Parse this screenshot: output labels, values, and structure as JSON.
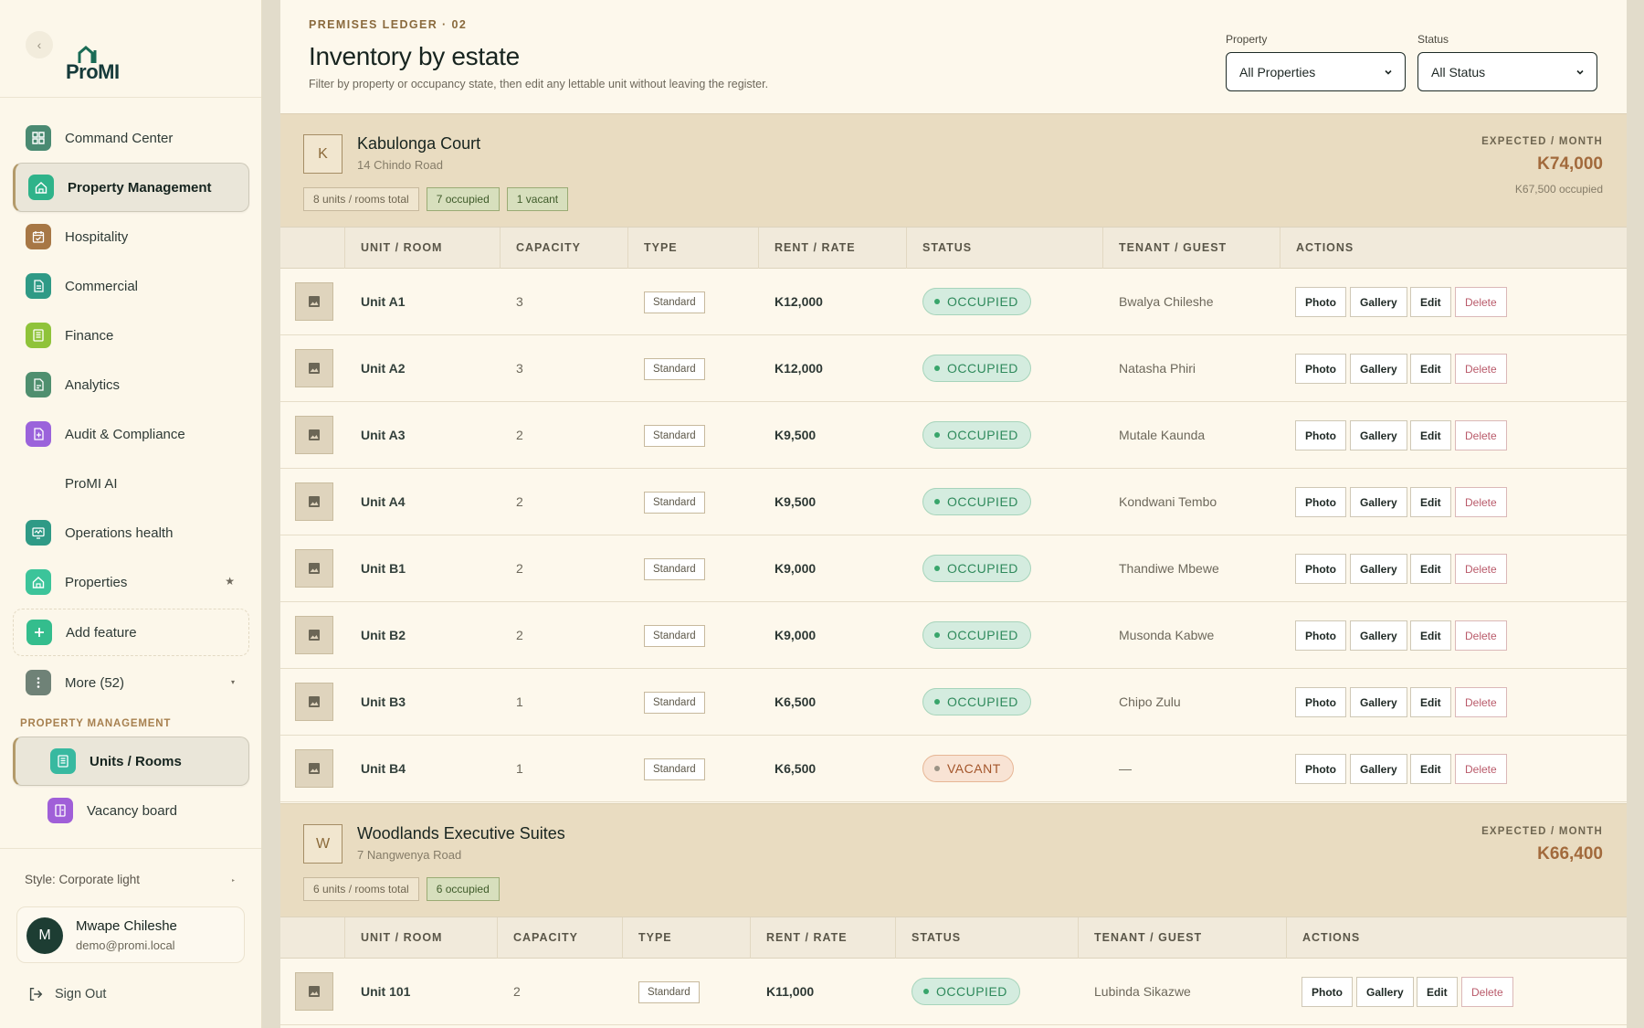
{
  "sidebar": {
    "logo": "ProMI",
    "nav": [
      {
        "label": "Command Center",
        "icon": "grid-icon",
        "color": "#4a8a72",
        "active": false
      },
      {
        "label": "Property Management",
        "icon": "home-icon",
        "color": "#2fb38a",
        "active": true
      },
      {
        "label": "Hospitality",
        "icon": "calendar-icon",
        "color": "#a77745",
        "active": false
      },
      {
        "label": "Commercial",
        "icon": "document-icon",
        "color": "#2f9a86",
        "active": false
      },
      {
        "label": "Finance",
        "icon": "ledger-icon",
        "color": "#8fc33a",
        "active": false
      },
      {
        "label": "Analytics",
        "icon": "report-icon",
        "color": "#4f8f6f",
        "active": false
      },
      {
        "label": "Audit & Compliance",
        "icon": "audit-icon",
        "color": "#9b63db",
        "active": false
      },
      {
        "label": "ProMI AI",
        "icon": "",
        "color": "",
        "active": false
      },
      {
        "label": "Operations health",
        "icon": "monitor-icon",
        "color": "#2f9a86",
        "active": false
      },
      {
        "label": "Properties",
        "icon": "home-icon",
        "color": "#3cc49a",
        "active": false,
        "star": "★"
      },
      {
        "label": "Add feature",
        "icon": "plus-icon",
        "color": "#34bd8d",
        "active": false
      },
      {
        "label": "More (52)",
        "icon": "more-icon",
        "color": "#6f8277",
        "active": false,
        "caret": "▾"
      }
    ],
    "section_label": "PROPERTY MANAGEMENT",
    "subnav": [
      {
        "label": "Units / Rooms",
        "icon": "units-icon",
        "color": "#38b9a0",
        "active": true
      },
      {
        "label": "Vacancy board",
        "icon": "board-icon",
        "color": "#a05fd8",
        "active": false
      }
    ],
    "style_label": "Style: Corporate light",
    "user": {
      "initial": "M",
      "name": "Mwape Chileshe",
      "email": "demo@promi.local"
    },
    "signout": "Sign Out"
  },
  "header": {
    "eyebrow": "PREMISES LEDGER · 02",
    "title": "Inventory by estate",
    "subtitle": "Filter by property or occupancy state, then edit any lettable unit without leaving the register.",
    "property_label": "Property",
    "property_value": "All Properties",
    "status_label": "Status",
    "status_value": "All Status"
  },
  "columns": [
    "UNIT / ROOM",
    "CAPACITY",
    "TYPE",
    "RENT / RATE",
    "STATUS",
    "TENANT / GUEST",
    "ACTIONS"
  ],
  "actions": {
    "photo": "Photo",
    "gallery": "Gallery",
    "edit": "Edit",
    "delete": "Delete"
  },
  "estates": [
    {
      "letter": "K",
      "name": "Kabulonga Court",
      "address": "14 Chindo Road",
      "chips": [
        {
          "text": "8 units / rooms total",
          "green": false
        },
        {
          "text": "7 occupied",
          "green": true
        },
        {
          "text": "1 vacant",
          "green": true
        }
      ],
      "expected_label": "EXPECTED / MONTH",
      "expected_value": "K74,000",
      "expected_occupied": "K67,500 occupied",
      "units": [
        {
          "unit": "Unit A1",
          "capacity": "3",
          "type": "Standard",
          "rent": "K12,000",
          "status": "OCCUPIED",
          "tenant": "Bwalya Chileshe"
        },
        {
          "unit": "Unit A2",
          "capacity": "3",
          "type": "Standard",
          "rent": "K12,000",
          "status": "OCCUPIED",
          "tenant": "Natasha Phiri"
        },
        {
          "unit": "Unit A3",
          "capacity": "2",
          "type": "Standard",
          "rent": "K9,500",
          "status": "OCCUPIED",
          "tenant": "Mutale Kaunda"
        },
        {
          "unit": "Unit A4",
          "capacity": "2",
          "type": "Standard",
          "rent": "K9,500",
          "status": "OCCUPIED",
          "tenant": "Kondwani Tembo"
        },
        {
          "unit": "Unit B1",
          "capacity": "2",
          "type": "Standard",
          "rent": "K9,000",
          "status": "OCCUPIED",
          "tenant": "Thandiwe Mbewe"
        },
        {
          "unit": "Unit B2",
          "capacity": "2",
          "type": "Standard",
          "rent": "K9,000",
          "status": "OCCUPIED",
          "tenant": "Musonda Kabwe"
        },
        {
          "unit": "Unit B3",
          "capacity": "1",
          "type": "Standard",
          "rent": "K6,500",
          "status": "OCCUPIED",
          "tenant": "Chipo Zulu"
        },
        {
          "unit": "Unit B4",
          "capacity": "1",
          "type": "Standard",
          "rent": "K6,500",
          "status": "VACANT",
          "tenant": "—"
        }
      ]
    },
    {
      "letter": "W",
      "name": "Woodlands Executive Suites",
      "address": "7 Nangwenya Road",
      "chips": [
        {
          "text": "6 units / rooms total",
          "green": false
        },
        {
          "text": "6 occupied",
          "green": true
        }
      ],
      "expected_label": "EXPECTED / MONTH",
      "expected_value": "K66,400",
      "expected_occupied": "",
      "units": [
        {
          "unit": "Unit 101",
          "capacity": "2",
          "type": "Standard",
          "rent": "K11,000",
          "status": "OCCUPIED",
          "tenant": "Lubinda Sikazwe"
        }
      ]
    }
  ]
}
